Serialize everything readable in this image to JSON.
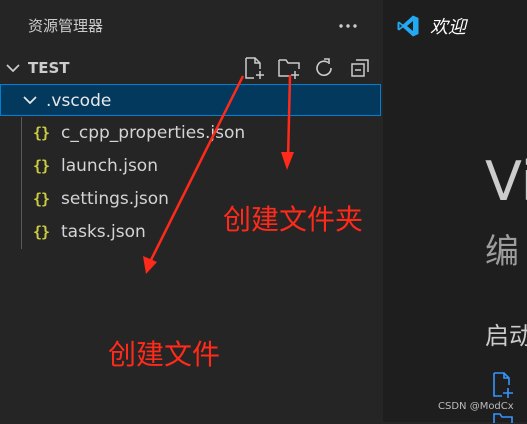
{
  "explorer": {
    "title": "资源管理器",
    "more_icon": "ellipsis-icon",
    "section_title": "TEST",
    "toolbar_icons": [
      "new-file-icon",
      "new-folder-icon",
      "refresh-icon",
      "collapse-all-icon"
    ],
    "folder": ".vscode",
    "files": [
      "c_cpp_properties.json",
      "launch.json",
      "settings.json",
      "tasks.json"
    ],
    "file_icon": "{}"
  },
  "editor": {
    "tab_label": "欢迎",
    "welcome_title": "Vi",
    "welcome_subtitle": "编",
    "start_heading": "启动"
  },
  "annotations": {
    "new_folder": "创建文件夹",
    "new_file": "创建文件",
    "color": "#ff2a1a"
  },
  "watermark": "CSDN @ModCx",
  "colors": {
    "sidebar_bg": "#252526",
    "editor_bg": "#1e1e1e",
    "selection_bg": "#04395e",
    "selection_border": "#007fd4",
    "json_icon": "#cbcb41",
    "vscode_blue": "#23a9f2"
  }
}
